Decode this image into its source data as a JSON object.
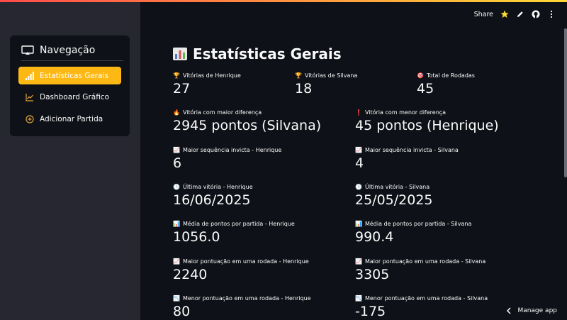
{
  "sidebar": {
    "title": "Navegação",
    "items": [
      {
        "label": "Estatísticas Gerais",
        "active": true
      },
      {
        "label": "Dashboard Gráfico",
        "active": false
      },
      {
        "label": "Adicionar Partida",
        "active": false
      }
    ]
  },
  "toolbar": {
    "share": "Share"
  },
  "page": {
    "title": "Estatísticas Gerais"
  },
  "metrics": [
    {
      "icon": "🏆",
      "label": "Vitórias de Henrique",
      "value": "27"
    },
    {
      "icon": "🏆",
      "label": "Vitórias de Silvana",
      "value": "18"
    },
    {
      "icon": "🎯",
      "label": "Total de Rodadas",
      "value": "45"
    },
    {
      "icon": "🔥",
      "label": "Vitória com maior diferença",
      "value": "2945 pontos (Silvana)"
    },
    {
      "icon": "❗",
      "label": "Vitória com menor diferença",
      "value": "45 pontos (Henrique)"
    },
    {
      "icon": "📈",
      "label": "Maior sequência invicta - Henrique",
      "value": "6"
    },
    {
      "icon": "📈",
      "label": "Maior sequência invicta - Silvana",
      "value": "4"
    },
    {
      "icon": "🕒",
      "label": "Última vitória - Henrique",
      "value": "16/06/2025"
    },
    {
      "icon": "🕒",
      "label": "Última vitória - Silvana",
      "value": "25/05/2025"
    },
    {
      "icon": "📊",
      "label": "Média de pontos por partida - Henrique",
      "value": "1056.0"
    },
    {
      "icon": "📊",
      "label": "Média de pontos por partida - Silvana",
      "value": "990.4"
    },
    {
      "icon": "📈",
      "label": "Maior pontuação em uma rodada - Henrique",
      "value": "2240"
    },
    {
      "icon": "📈",
      "label": "Maior pontuação em uma rodada - Silvana",
      "value": "3305"
    },
    {
      "icon": "📉",
      "label": "Menor pontuação em uma rodada - Henrique",
      "value": "80"
    },
    {
      "icon": "📉",
      "label": "Menor pontuação em uma rodada - Silvana",
      "value": "-175"
    }
  ],
  "footer": {
    "manage": "Manage app"
  },
  "colors": {
    "accent": "#fdb813",
    "background": "#0e1117",
    "sidebar": "#262730"
  }
}
